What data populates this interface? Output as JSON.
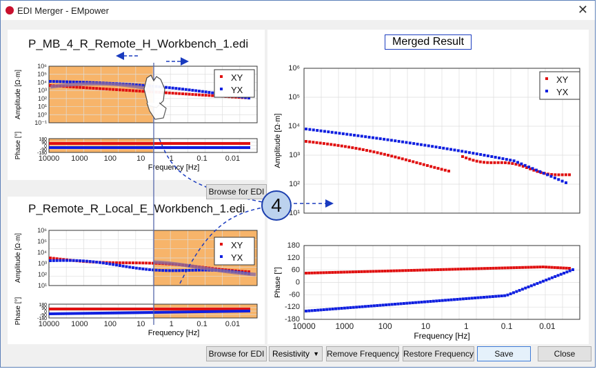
{
  "window": {
    "title": "EDI Merger - EMpower",
    "close_glyph": "✕"
  },
  "plots": {
    "top": {
      "title": "P_MB_4_R_Remote_H_Workbench_1.edi",
      "browse_label": "Browse for EDI"
    },
    "bottom": {
      "title": "P_Remote_R_Local_E_Workbench_1.edi",
      "browse_label": "Browse for EDI"
    },
    "merged": {
      "title": "Merged Result"
    },
    "labels": {
      "amplitude": "Amplitude [Ω·m]",
      "phase": "Phase [°]",
      "frequency": "Frequency [Hz]",
      "freq_ticks": [
        "10000",
        "1000",
        "100",
        "10",
        "1",
        "0.1",
        "0.01"
      ],
      "amp_ticks_small": [
        "10⁶",
        "10⁵",
        "10⁴",
        "10³",
        "10²",
        "10¹",
        "10⁰",
        "10⁻¹"
      ],
      "amp_ticks_merged": [
        "10⁶",
        "10⁵",
        "10⁴",
        "10³",
        "10²",
        "10¹"
      ],
      "phase_ticks_merged": [
        "180",
        "120",
        "60",
        "0",
        "-60",
        "-120",
        "-180"
      ],
      "phase_ticks_small": [
        "180",
        "90",
        "0",
        "-90",
        "-180"
      ]
    },
    "legend": {
      "xy": "XY",
      "yx": "YX"
    }
  },
  "toolbar": {
    "resistivity": "Resistivity",
    "remove_frequency": "Remove Frequency",
    "restore_frequency": "Restore Frequency",
    "save": "Save",
    "close": "Close"
  },
  "annotation": {
    "step": "4"
  },
  "colors": {
    "xy": "#e01010",
    "yx": "#1020e0",
    "highlight": "#f7b46a",
    "accent": "#1a3bbf"
  }
}
